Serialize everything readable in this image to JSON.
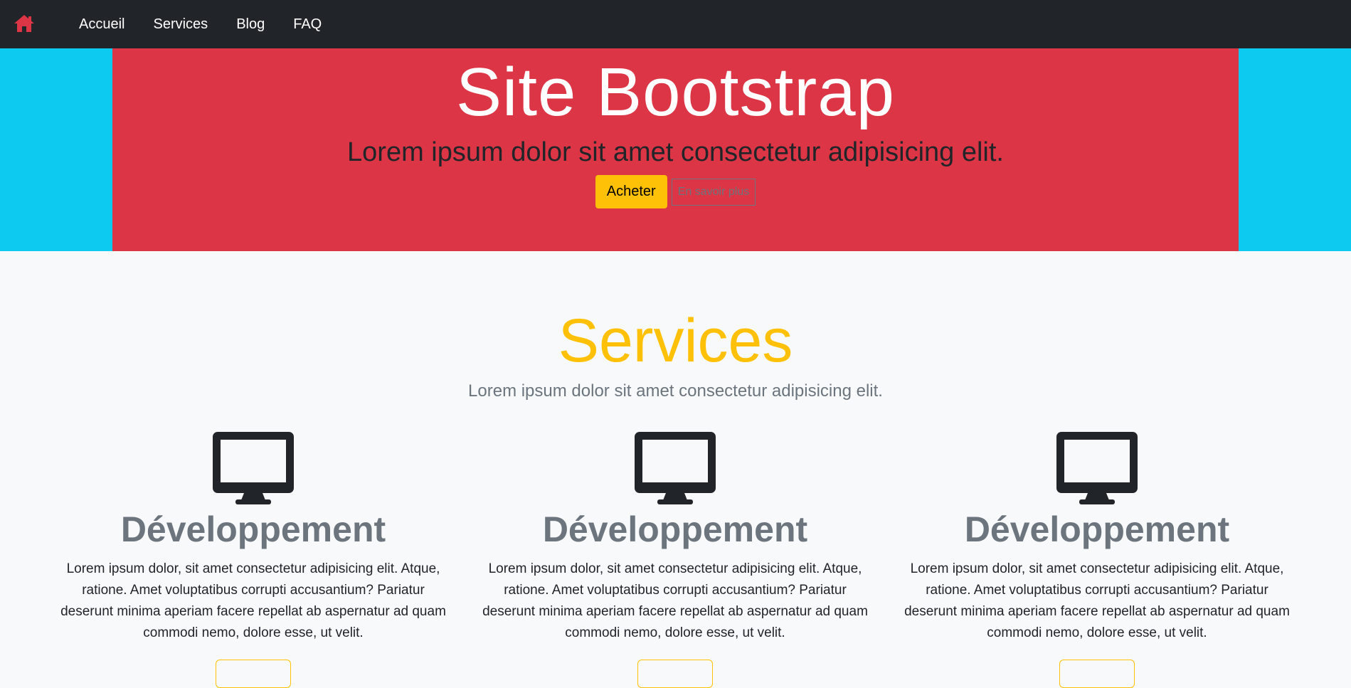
{
  "nav": {
    "home_icon": "home-icon",
    "links": [
      "Accueil",
      "Services",
      "Blog",
      "FAQ"
    ]
  },
  "hero": {
    "title": "Site Bootstrap",
    "subtitle": "Lorem ipsum dolor sit amet consectetur adipisicing elit.",
    "buy_label": "Acheter",
    "more_label": "En savoir plus"
  },
  "services": {
    "title": "Services",
    "subtitle": "Lorem ipsum dolor sit amet consectetur adipisicing elit.",
    "cards": [
      {
        "icon": "desktop-icon",
        "title": "Développement",
        "text": "Lorem ipsum dolor, sit amet consectetur adipisicing elit. Atque, ratione. Amet voluptatibus corrupti accusantium? Pariatur deserunt minima aperiam facere repellat ab aspernatur ad quam commodi nemo, dolore esse, ut velit."
      },
      {
        "icon": "desktop-icon",
        "title": "Développement",
        "text": "Lorem ipsum dolor, sit amet consectetur adipisicing elit. Atque, ratione. Amet voluptatibus corrupti accusantium? Pariatur deserunt minima aperiam facere repellat ab aspernatur ad quam commodi nemo, dolore esse, ut velit."
      },
      {
        "icon": "desktop-icon",
        "title": "Développement",
        "text": "Lorem ipsum dolor, sit amet consectetur adipisicing elit. Atque, ratione. Amet voluptatibus corrupti accusantium? Pariatur deserunt minima aperiam facere repellat ab aspernatur ad quam commodi nemo, dolore esse, ut velit."
      }
    ]
  },
  "colors": {
    "navbar": "#212529",
    "hero_outer": "#0dcaf0",
    "hero_inner": "#dc3545",
    "accent": "#ffc107",
    "muted": "#6c757d"
  }
}
